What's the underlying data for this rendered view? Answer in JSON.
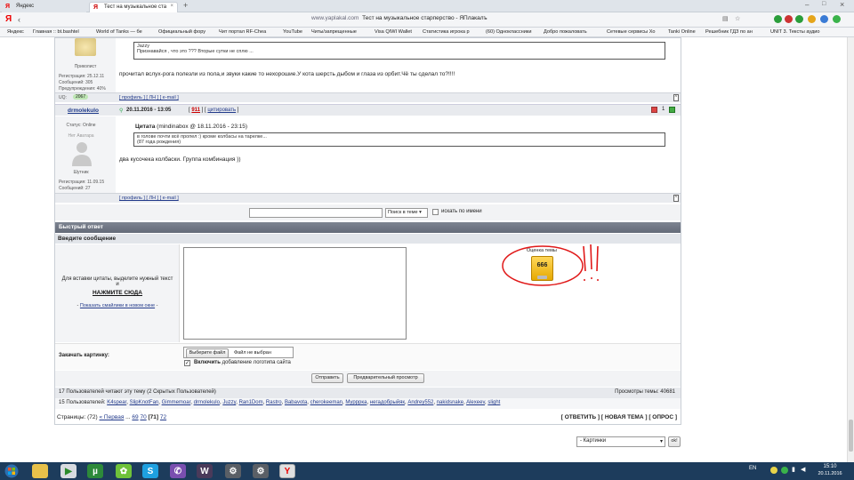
{
  "tabs": [
    {
      "label": "Яндекс",
      "icon": "yandex-icon"
    },
    {
      "label": "Тест на музыкальное ста",
      "icon": "yaplakal-icon"
    }
  ],
  "address": {
    "domain": "www.yaplakal.com",
    "title": "Тест на музыкальное старперство - ЯПлакалъ"
  },
  "bookmarks": [
    "Яндекс",
    "Главная :: bt.bashtel",
    "World of Tanks — бе",
    "Официальный фору",
    "Чит портал RF-Chea",
    "YouTube",
    "Читы/запрещенные",
    "Visa QIWI Wallet",
    "Статистика игрока р",
    "(60) Одноклассники",
    "Добро пожаловать",
    "Сетевые сервисы Хо",
    "Tanki Online",
    "Решебник ГДЗ по ан",
    "UNIT 3. Тексты аудио"
  ],
  "post1": {
    "user_title": "Приколист",
    "reg": "Регистрация: 25.12.11",
    "msgs": "Сообщений: 305",
    "warn": "Предупреждения: 40%",
    "uq_label": "UQ:",
    "uq_value": "2067",
    "quote_name": "Jazzy",
    "quote_text": "Признавайся , что это ??? Вторые сутки не сплю ...",
    "body": "прочитал вслух-рога полезли из пола,и звуки какие то нехорошие.У кота шерсть дыбом и глаза из орбит.Чё ты сделал то?!!!!",
    "links": "[ профиль ] [ ЛН ] [ e-mail ]"
  },
  "post2": {
    "username": "drmolekulo",
    "date": "20.11.2016 - 13:05",
    "num": "911",
    "cite": "цитировать",
    "status": "Статус: Online",
    "no_avatar": "Нет Аватара",
    "user_title": "Шутник",
    "reg": "Регистрация: 11.09.15",
    "msgs": "Сообщений: 27",
    "quote_label": "Цитата",
    "quote_src": "(mindinabox @ 18.11.2016 - 23:15)",
    "quote_line1": "в голове почти всё пропел :) кроме колбасы на тарелке...",
    "quote_line2": "(87 года рождения)",
    "body": "два кусочека колбаски. Группа комбинация ))",
    "links": "[ профиль ] [ ЛН ] [ e-mail ]",
    "votes": "1"
  },
  "search": {
    "placeholder": "",
    "select": "Поиск в теме",
    "checkbox": "искать по имени"
  },
  "quick_reply": {
    "header": "Быстрый ответ",
    "enter": "Введите сообщение",
    "hint1": "Для вставки цитаты, выделите нужный текст и",
    "hint2": "НАЖМИТЕ СЮДА",
    "show_smileys": "Показать смайлики в новом окне",
    "rating_label": "Оценка темы",
    "rating_value": "666",
    "annotation": "!!!",
    "upload_label": "Закачать картинку:",
    "choose_file": "Выберите файл",
    "no_file": "Файл не выбран",
    "logo_bold": "Включить",
    "logo_rest": "добавление логотипа сайта",
    "send": "Отправить",
    "preview": "Предварительный просмотр"
  },
  "stats": {
    "reading": "17 Пользователей читают эту тему (2 Скрытых Пользователей)",
    "views": "Просмотры темы: 40681",
    "users_label": "15 Пользователей:",
    "users": [
      "K4spear",
      "SlipKnotFan",
      "Gimmemoar",
      "drmolekulo",
      "Juzzy",
      "Ran1Dom",
      "Rastro",
      "Babavota",
      "cherokeeman",
      "Мурррка",
      "негадобрыйяк",
      "Andrey552",
      "nakidsnake",
      "Alexeev",
      "slight"
    ]
  },
  "pages": {
    "label": "Страницы:",
    "total": "(72)",
    "first": "« Первая",
    "dots": "...",
    "p69": "69",
    "p70": "70",
    "current": "[71]",
    "p72": "72",
    "actions": "[ ОТВЕТИТЬ ] [ НОВАЯ ТЕМА ] [ ОПРОС ]"
  },
  "jump": {
    "select": "- Картинки",
    "ok": "ok!"
  },
  "tray": {
    "lang": "EN",
    "time": "15:10",
    "date": "20.11.2016"
  }
}
